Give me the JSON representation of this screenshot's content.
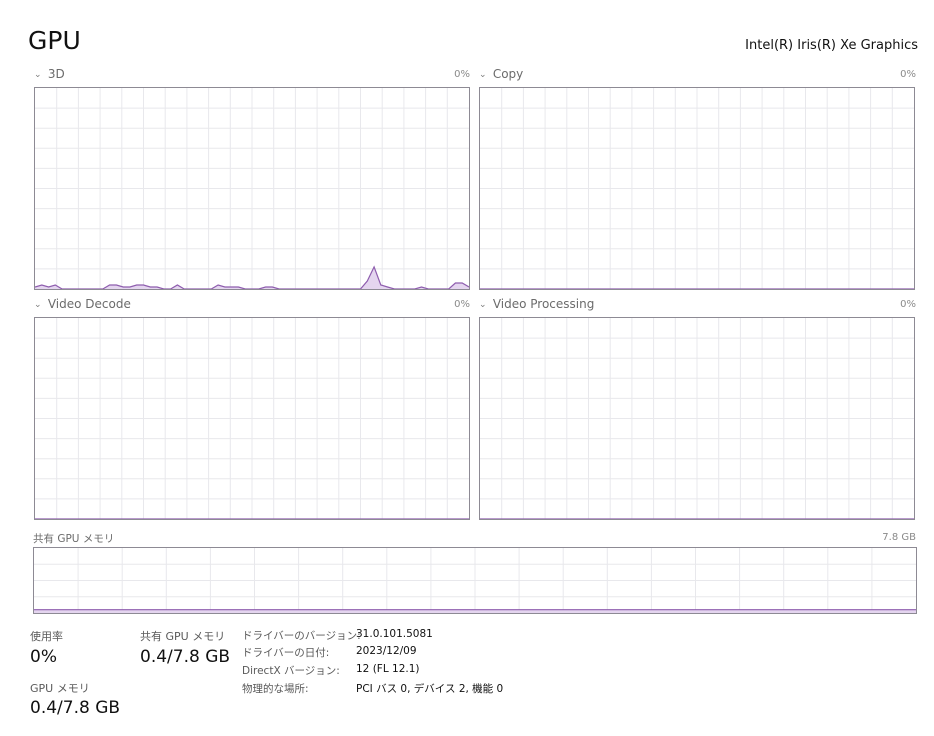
{
  "header": {
    "title": "GPU",
    "device_name": "Intel(R) Iris(R) Xe Graphics"
  },
  "engines": [
    {
      "label": "3D",
      "percent": "0%"
    },
    {
      "label": "Copy",
      "percent": "0%"
    },
    {
      "label": "Video Decode",
      "percent": "0%"
    },
    {
      "label": "Video Processing",
      "percent": "0%"
    }
  ],
  "shared_memory": {
    "label": "共有 GPU メモリ",
    "max": "7.8 GB"
  },
  "stats": {
    "utilization_label": "使用率",
    "utilization_value": "0%",
    "shared_label": "共有 GPU メモリ",
    "shared_value": "0.4/7.8 GB",
    "gpu_mem_label": "GPU メモリ",
    "gpu_mem_value": "0.4/7.8 GB"
  },
  "info": [
    {
      "key": "ドライバーのバージョン:",
      "value": "31.0.101.5081"
    },
    {
      "key": "ドライバーの日付:",
      "value": "2023/12/09"
    },
    {
      "key": "DirectX バージョン:",
      "value": "12 (FL 12.1)"
    },
    {
      "key": "物理的な場所:",
      "value": "PCI バス 0, デバイス 2, 機能 0"
    }
  ],
  "colors": {
    "graph_line": "#8e5dae",
    "graph_fill": "#e4d5ef",
    "grid": "#e8e8ec",
    "border": "#8d8a94"
  },
  "chart_data": [
    {
      "type": "area",
      "title": "3D",
      "ylim": [
        0,
        100
      ],
      "y": [
        1,
        2,
        1,
        2,
        0,
        0,
        0,
        0,
        0,
        0,
        0,
        2,
        2,
        1,
        1,
        2,
        2,
        1,
        1,
        0,
        0,
        2,
        0,
        0,
        0,
        0,
        0,
        2,
        1,
        1,
        1,
        0,
        0,
        0,
        1,
        1,
        0,
        0,
        0,
        0,
        0,
        0,
        0,
        0,
        0,
        0,
        0,
        0,
        0,
        4,
        11,
        2,
        1,
        0,
        0,
        0,
        0,
        1,
        0,
        0,
        0,
        0,
        3,
        3,
        1
      ]
    },
    {
      "type": "area",
      "title": "Copy",
      "ylim": [
        0,
        100
      ],
      "y": [
        0,
        0,
        0
      ]
    },
    {
      "type": "area",
      "title": "Video Decode",
      "ylim": [
        0,
        100
      ],
      "y": [
        0,
        0,
        0
      ]
    },
    {
      "type": "area",
      "title": "Video Processing",
      "ylim": [
        0,
        100
      ],
      "y": [
        0,
        0,
        0
      ]
    },
    {
      "type": "area",
      "title": "共有 GPU メモリ",
      "ylim": [
        0,
        7.8
      ],
      "y": [
        0.4,
        0.4,
        0.4
      ]
    }
  ]
}
